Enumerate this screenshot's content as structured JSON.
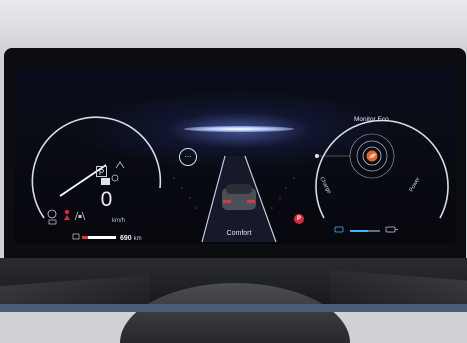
{
  "cluster": {
    "speed_value": "0",
    "speed_unit": "km/h",
    "range_value": "690",
    "range_unit": "km",
    "drive_mode": "Comfort",
    "gear_indicator": "P",
    "parking_brake_indicator": "P",
    "more_button_glyph": "...",
    "eco_title": "Monitor Eco",
    "eco_label_charge": "Charge",
    "eco_label_power": "Power",
    "fuel_level": 0.18
  },
  "icons": {
    "left_cluster": [
      "autohold-icon",
      "seatbelt-icon",
      "lane-assist-icon",
      "battery-icon",
      "eco-leaf-icon"
    ],
    "right_cluster": [
      "camera-icon",
      "charge-plug-icon"
    ]
  },
  "colors": {
    "gauge_ring": "#d7dde6",
    "warning_red": "#e0283a",
    "eco_orange": "#e4682a",
    "glow_blue": "#7a8cff",
    "accent_cyan": "#3fb5ff"
  }
}
